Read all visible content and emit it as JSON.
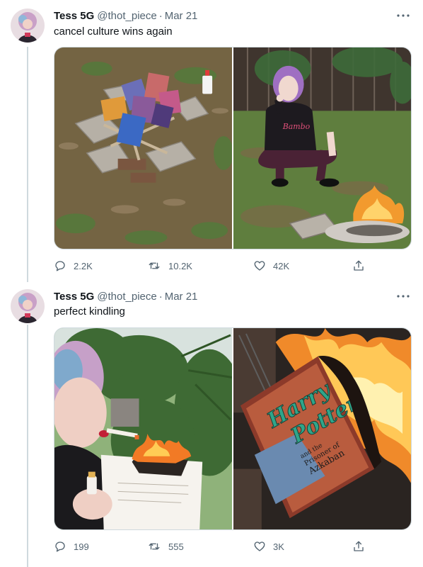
{
  "tweets": [
    {
      "author": {
        "name": "Tess 5G",
        "handle": "@thot_piece"
      },
      "separator": "·",
      "date": "Mar 21",
      "text": "cancel culture wins again",
      "stats": {
        "replies": "2.2K",
        "retweets": "10.2K",
        "likes": "42K"
      },
      "photos": [
        "books-on-firepit-photo",
        "woman-posing-by-fire-photo"
      ]
    },
    {
      "author": {
        "name": "Tess 5G",
        "handle": "@thot_piece"
      },
      "separator": "·",
      "date": "Mar 21",
      "text": "perfect kindling",
      "stats": {
        "replies": "199",
        "retweets": "555",
        "likes": "3K"
      },
      "photos": [
        "lighting-cigarette-on-burning-page-photo",
        "burning-book-cover-photo"
      ],
      "book_cover": {
        "line1": "Harry",
        "line2": "Potter",
        "subtitle_line1": "and the",
        "subtitle_line2": "Prisoner of",
        "subtitle_line3": "Azkaban"
      }
    }
  ],
  "icons": {
    "more": "more-horizontal-icon",
    "reply": "reply-bubble-icon",
    "retweet": "retweet-icon",
    "like": "heart-icon",
    "share": "share-icon"
  },
  "colors": {
    "text_primary": "#0f1419",
    "text_secondary": "#536471",
    "thread_line": "#cfd9de",
    "background": "#ffffff"
  }
}
